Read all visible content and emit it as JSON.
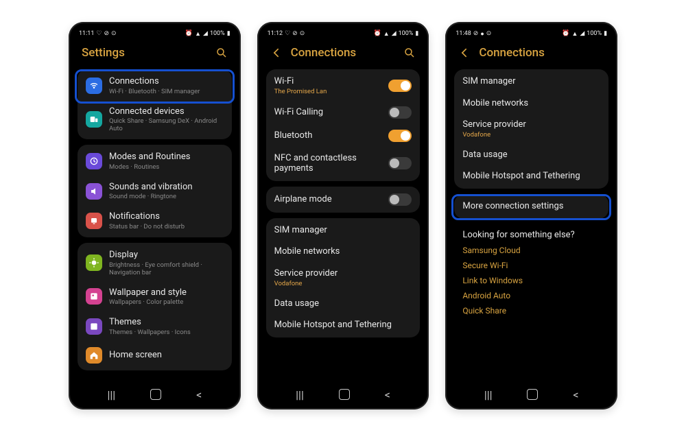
{
  "phone1": {
    "status_time": "11:11",
    "status_pct": "100%",
    "title": "Settings",
    "items": [
      {
        "label": "Connections",
        "sub": "Wi-Fi · Bluetooth · SIM manager",
        "icon": "wifi",
        "color": "#2b6de3",
        "hl": true
      },
      {
        "label": "Connected devices",
        "sub": "Quick Share · Samsung DeX · Android Auto",
        "icon": "devices",
        "color": "#14a7a0"
      },
      {
        "label": "Modes and Routines",
        "sub": "Modes · Routines",
        "icon": "routine",
        "color": "#6a4ad9",
        "gap": true
      },
      {
        "label": "Sounds and vibration",
        "sub": "Sound mode · Ringtone",
        "icon": "sound",
        "color": "#8a52d6"
      },
      {
        "label": "Notifications",
        "sub": "Status bar · Do not disturb",
        "icon": "notif",
        "color": "#d9524a"
      },
      {
        "label": "Display",
        "sub": "Brightness · Eye comfort shield · Navigation bar",
        "icon": "display",
        "color": "#7fb520",
        "gap": true
      },
      {
        "label": "Wallpaper and style",
        "sub": "Wallpapers · Color palette",
        "icon": "wall",
        "color": "#d44291"
      },
      {
        "label": "Themes",
        "sub": "Themes · Wallpapers · Icons",
        "icon": "theme",
        "color": "#7a48bf"
      },
      {
        "label": "Home screen",
        "sub": "",
        "icon": "home",
        "color": "#e08a2a"
      }
    ]
  },
  "phone2": {
    "status_time": "11:12",
    "status_pct": "100%",
    "title": "Connections",
    "items": [
      {
        "label": "Wi-Fi",
        "sub": "The Promised Lan",
        "accent": true,
        "toggle": "on"
      },
      {
        "label": "Wi-Fi Calling",
        "toggle": "off"
      },
      {
        "label": "Bluetooth",
        "toggle": "on"
      },
      {
        "label": "NFC and contactless payments",
        "toggle": "off"
      },
      {
        "label": "Airplane mode",
        "toggle": "off",
        "gap": true
      },
      {
        "label": "SIM manager",
        "gap": true
      },
      {
        "label": "Mobile networks"
      },
      {
        "label": "Service provider",
        "sub": "Vodafone",
        "accent": true
      },
      {
        "label": "Data usage"
      },
      {
        "label": "Mobile Hotspot and Tethering"
      }
    ]
  },
  "phone3": {
    "status_time": "11:48",
    "status_pct": "100%",
    "title": "Connections",
    "items": [
      {
        "label": "SIM manager"
      },
      {
        "label": "Mobile networks"
      },
      {
        "label": "Service provider",
        "sub": "Vodafone",
        "accent": true
      },
      {
        "label": "Data usage"
      },
      {
        "label": "Mobile Hotspot and Tethering"
      },
      {
        "label": "More connection settings",
        "gap": true,
        "hl": true
      }
    ],
    "looking_title": "Looking for something else?",
    "links": [
      "Samsung Cloud",
      "Secure Wi-Fi",
      "Link to Windows",
      "Android Auto",
      "Quick Share"
    ]
  }
}
